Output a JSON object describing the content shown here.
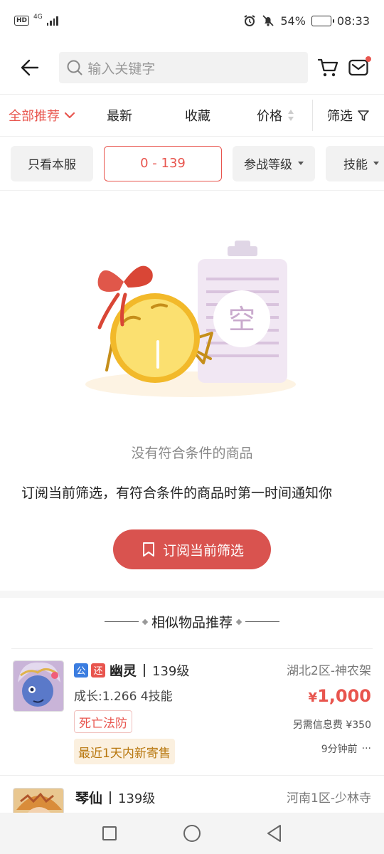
{
  "statusbar": {
    "hd": "HD",
    "network": "4G",
    "battery_pct": "54%",
    "battery_level": 0.54,
    "time": "08:33"
  },
  "topbar": {
    "search_placeholder": "输入关键字"
  },
  "sortbar": {
    "all": "全部推荐",
    "newest": "最新",
    "favorites": "收藏",
    "price": "价格",
    "filter": "筛选"
  },
  "chips": {
    "server_only": "只看本服",
    "range": "0 - 139",
    "battle_level": "参战等级",
    "skills": "技能"
  },
  "empty": {
    "illustration_char": "空",
    "message": "没有符合条件的商品",
    "subscribe_tip": "订阅当前筛选，有符合条件的商品时第一时间通知你",
    "subscribe_button": "订阅当前筛选"
  },
  "similar": {
    "title": "相似物品推荐",
    "items": [
      {
        "tag_public": "公",
        "tag_return": "还",
        "name": "幽灵",
        "level": "139级",
        "growth": "成长:1.266 4技能",
        "badge": "死亡法防",
        "badge2": "最近1天内新寄售",
        "server": "湖北2区-神农架",
        "currency": "¥",
        "price": "1,000",
        "fee": "另需信息费 ¥350",
        "time": "9分钟前",
        "more": "···"
      },
      {
        "name": "琴仙",
        "level": "139级",
        "server": "河南1区-少林寺"
      }
    ]
  },
  "colors": {
    "accent": "#e8554e",
    "button": "#d9534f"
  }
}
